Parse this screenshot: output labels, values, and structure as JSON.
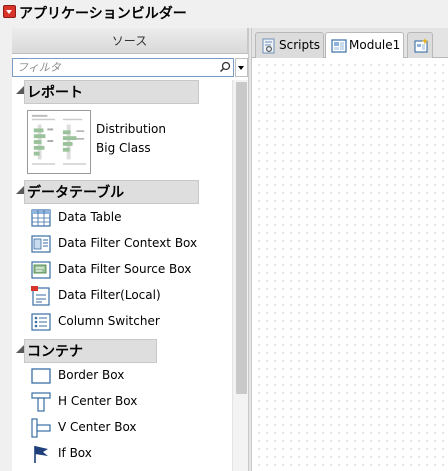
{
  "app": {
    "title": "アプリケーションビルダー"
  },
  "sources": {
    "header": "ソース",
    "filter_placeholder": "フィルタ"
  },
  "sections": {
    "report": {
      "label": "レポート",
      "items": [
        {
          "line1": "Distribution",
          "line2": "Big Class"
        }
      ]
    },
    "data_table": {
      "label": "データテーブル",
      "items": [
        {
          "label": "Data Table",
          "icon": "data-table-icon"
        },
        {
          "label": "Data Filter Context Box",
          "icon": "filter-context-icon"
        },
        {
          "label": "Data Filter Source Box",
          "icon": "filter-source-icon"
        },
        {
          "label": "Data Filter(Local)",
          "icon": "local-filter-icon"
        },
        {
          "label": "Column Switcher",
          "icon": "column-switcher-icon"
        }
      ]
    },
    "container": {
      "label": "コンテナ",
      "items": [
        {
          "label": "Border Box",
          "icon": "border-box-icon"
        },
        {
          "label": "H Center Box",
          "icon": "h-center-box-icon"
        },
        {
          "label": "V Center Box",
          "icon": "v-center-box-icon"
        },
        {
          "label": "If Box",
          "icon": "flag-icon"
        }
      ]
    }
  },
  "tabs": [
    {
      "label": "Scripts",
      "active": false
    },
    {
      "label": "Module1",
      "active": true
    },
    {
      "label": "",
      "active": false
    }
  ],
  "colors": {
    "accent_red": "#d9342b",
    "icon_blue": "#3a6ea5",
    "selection_blue": "#7a9cc6"
  }
}
